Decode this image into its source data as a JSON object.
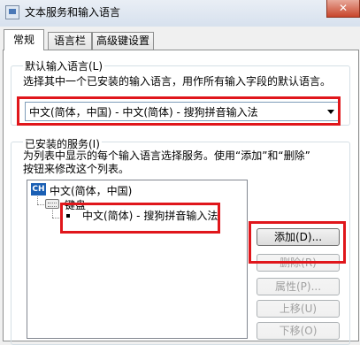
{
  "window": {
    "title": "文本服务和输入语言",
    "close_label": "✕"
  },
  "tabs": [
    {
      "label": "常规"
    },
    {
      "label": "语言栏"
    },
    {
      "label": "高级键设置"
    }
  ],
  "default_language": {
    "label": "默认输入语言(L)",
    "description": "选择其中一个已安装的输入语言，用作所有输入字段的默认语言。",
    "selected": "中文(简体，中国) - 中文(简体) - 搜狗拼音输入法"
  },
  "installed_services": {
    "label": "已安装的服务(I)",
    "description_line1": "为列表中显示的每个输入语言选择服务。使用“添加”和“删除”",
    "description_line2": "按钮来修改这个列表。",
    "language_badge": "CH",
    "language": "中文(简体，中国)",
    "category": "键盘",
    "service": "中文(简体) - 搜狗拼音输入法"
  },
  "buttons": {
    "add": "添加(D)...",
    "remove": "删除(R)",
    "properties": "属性(P)...",
    "move_up": "上移(U)",
    "move_down": "下移(O)"
  },
  "icons": {
    "title": "settings-window-icon",
    "language": "ch-language-icon",
    "keyboard": "keyboard-icon"
  }
}
